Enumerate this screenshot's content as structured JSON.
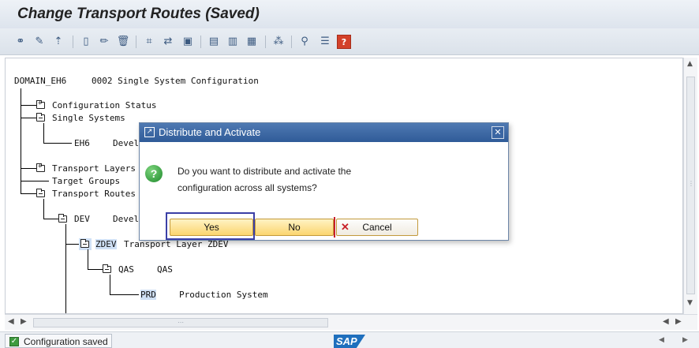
{
  "window": {
    "title": "Change Transport Routes (Saved)"
  },
  "toolbar": {
    "icons": [
      "glasses-edit-icon",
      "pencil-glasses-icon",
      "hierarchy-up-icon",
      "new-document-icon",
      "edit-pencil-icon",
      "delete-trash-icon",
      "expand-icon",
      "collapse-icon",
      "lock-icon",
      "grid-icon",
      "grid-detail-icon",
      "grid-export-icon",
      "config-icon",
      "find-icon",
      "notes-icon",
      "help-icon"
    ]
  },
  "tree": {
    "root": {
      "code": "DOMAIN_EH6",
      "desc": "0002 Single System Configuration"
    },
    "config_status": "Configuration Status",
    "single_systems": "Single Systems",
    "eh6": {
      "code": "EH6",
      "desc": "Devel"
    },
    "transport_layers": "Transport Layers",
    "target_groups": "Target Groups",
    "transport_routes": "Transport Routes",
    "dev": {
      "code": "DEV",
      "desc": "Devel"
    },
    "zdev": {
      "code": "ZDEV",
      "desc": "Transport Layer ZDEV"
    },
    "qas": {
      "code": "QAS",
      "desc": "QAS"
    },
    "prd": {
      "code": "PRD",
      "desc": "Production System"
    }
  },
  "dialog": {
    "title": "Distribute and Activate",
    "message_line1": "Do you want to distribute and activate the",
    "message_line2": "configuration across all systems?",
    "yes_label": "Yes",
    "no_label": "No",
    "cancel_label": "Cancel"
  },
  "status": {
    "message": "Configuration saved",
    "logo": "SAP"
  },
  "colors": {
    "dialog_title": "#3b66a3",
    "button": "#fbd56f",
    "focus": "#3b3fa6",
    "success": "#3f9b3f"
  }
}
